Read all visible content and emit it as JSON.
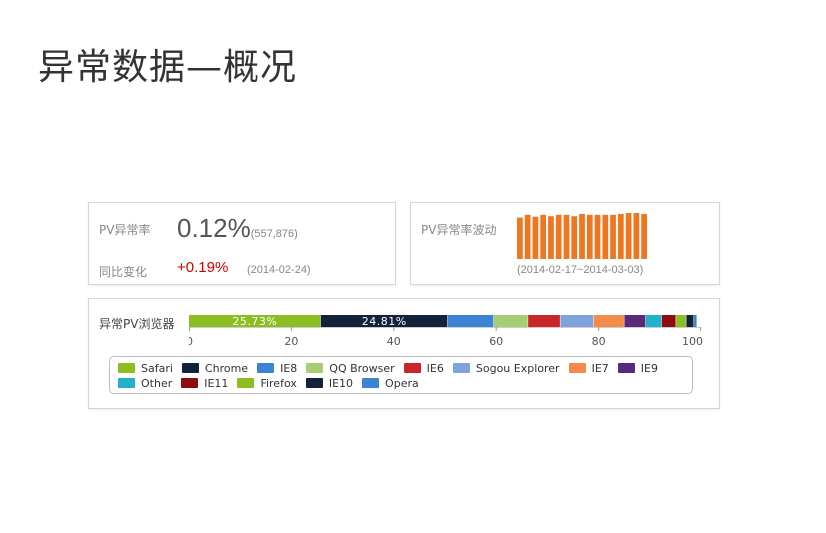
{
  "page": {
    "title": "异常数据—概况"
  },
  "rate_card": {
    "label": "PV异常率",
    "value": "0.12%",
    "value_sub": "(557,876)",
    "yoy_label": "同比变化",
    "yoy_value": "+0.19%",
    "yoy_date": "(2014-02-24)",
    "yoy_color": "#cc0000"
  },
  "wave_card": {
    "label": "PV异常率波动",
    "range": "(2014-02-17~2014-03-03)",
    "bar_color": "#ee7722",
    "relative_heights": [
      0.9,
      0.96,
      0.92,
      0.96,
      0.93,
      0.96,
      0.96,
      0.93,
      0.98,
      0.96,
      0.96,
      0.96,
      0.96,
      0.98,
      1.0,
      1.0,
      0.98
    ]
  },
  "browser_card": {
    "label": "异常PV浏览器",
    "axis_ticks": [
      "0",
      "20",
      "40",
      "60",
      "80",
      "100"
    ]
  },
  "chart_data": {
    "type": "bar",
    "orientation": "horizontal-stacked-100",
    "xlim": [
      0,
      100
    ],
    "series": [
      {
        "name": "Safari",
        "value": 25.73,
        "label": "25.73%",
        "color": "#8cbd21"
      },
      {
        "name": "Chrome",
        "value": 24.81,
        "label": "24.81%",
        "color": "#13223a"
      },
      {
        "name": "IE8",
        "value": 9,
        "color": "#3a84d3"
      },
      {
        "name": "QQ Browser",
        "value": 6.7,
        "color": "#a6cc74"
      },
      {
        "name": "IE6",
        "value": 6.3,
        "color": "#c9262a"
      },
      {
        "name": "Sogou Explorer",
        "value": 6.5,
        "color": "#7fa4dd"
      },
      {
        "name": "IE7",
        "value": 6,
        "color": "#f28c48"
      },
      {
        "name": "IE9",
        "value": 4.2,
        "color": "#5a2a7a"
      },
      {
        "name": "Other",
        "value": 3.1,
        "color": "#21b1cb"
      },
      {
        "name": "IE11",
        "value": 2.8,
        "color": "#8e0b10"
      },
      {
        "name": "Firefox",
        "value": 2,
        "color": "#8cbd21"
      },
      {
        "name": "IE10",
        "value": 1.5,
        "color": "#13223a"
      },
      {
        "name": "Opera",
        "value": 0.6,
        "color": "#3a84d3"
      }
    ]
  }
}
